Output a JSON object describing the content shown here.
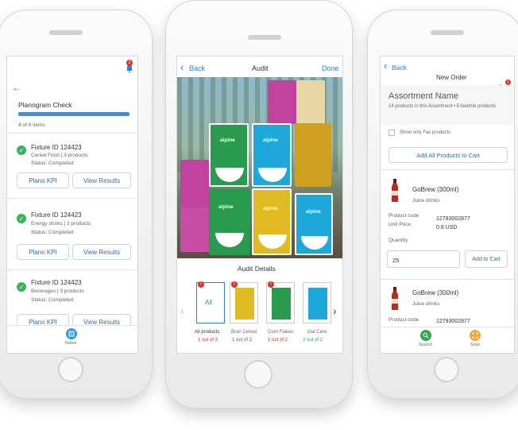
{
  "left": {
    "back_icon": "arrow-left-icon",
    "notif_count": "2",
    "title": "Planogram Check",
    "progress_label": "4 of 4 items",
    "progress": 1.0,
    "fixtures": [
      {
        "name": "Fixture ID 124423",
        "category": "Cereal Food | 3 products",
        "status": "Status: Completed",
        "btn1": "Plano KPI",
        "btn2": "View Results"
      },
      {
        "name": "Fixture ID 124423",
        "category": "Energy drinks | 3 products",
        "status": "Status: Completed",
        "btn1": "Plano KPI",
        "btn2": "View Results"
      },
      {
        "name": "Fixture ID 124423",
        "category": "Beverages | 3 products",
        "status": "Status: Completed",
        "btn1": "Plano KPI",
        "btn2": "View Results"
      }
    ],
    "footer_label": "Notes"
  },
  "center": {
    "back_label": "Back",
    "title": "Audit",
    "done_label": "Done",
    "section_title": "Audit Details",
    "brand": "alpine",
    "thumbs": [
      {
        "title": "All products",
        "count": "1 out of 3",
        "inner": "All",
        "color": "#c0392b"
      },
      {
        "title": "Bran Cereal",
        "count": "1 out of 2",
        "color": "#c0392b"
      },
      {
        "title": "Corn Flakes",
        "count": "1 out of 2",
        "color": "#c0392b"
      },
      {
        "title": "Oat Cere",
        "count": "2 out of 2",
        "color": "#2e9e62"
      }
    ]
  },
  "right": {
    "back_label": "Back",
    "title": "New Order",
    "cart_count": "1",
    "assortment_title": "Assortment Name",
    "assortment_sub": "14 products in this Assortment • 5 favorite products",
    "fav_label": "Show only Fav products",
    "add_all_label": "Add All Products to Cart",
    "product": {
      "name": "GoBrew (300ml)",
      "type": "Juice drinks",
      "code_label": "Product code",
      "code": "12793002877",
      "price_label": "Unit Price",
      "price": "0.8 USD",
      "qty_label": "Quantity",
      "qty": "25",
      "add_label": "Add to Cart"
    },
    "product2": {
      "name": "GoBrew (300ml)",
      "type": "Juice drinks",
      "code_label": "Product code",
      "code": "12793002877"
    },
    "footer_search": "Search",
    "footer_scan": "Scan"
  }
}
